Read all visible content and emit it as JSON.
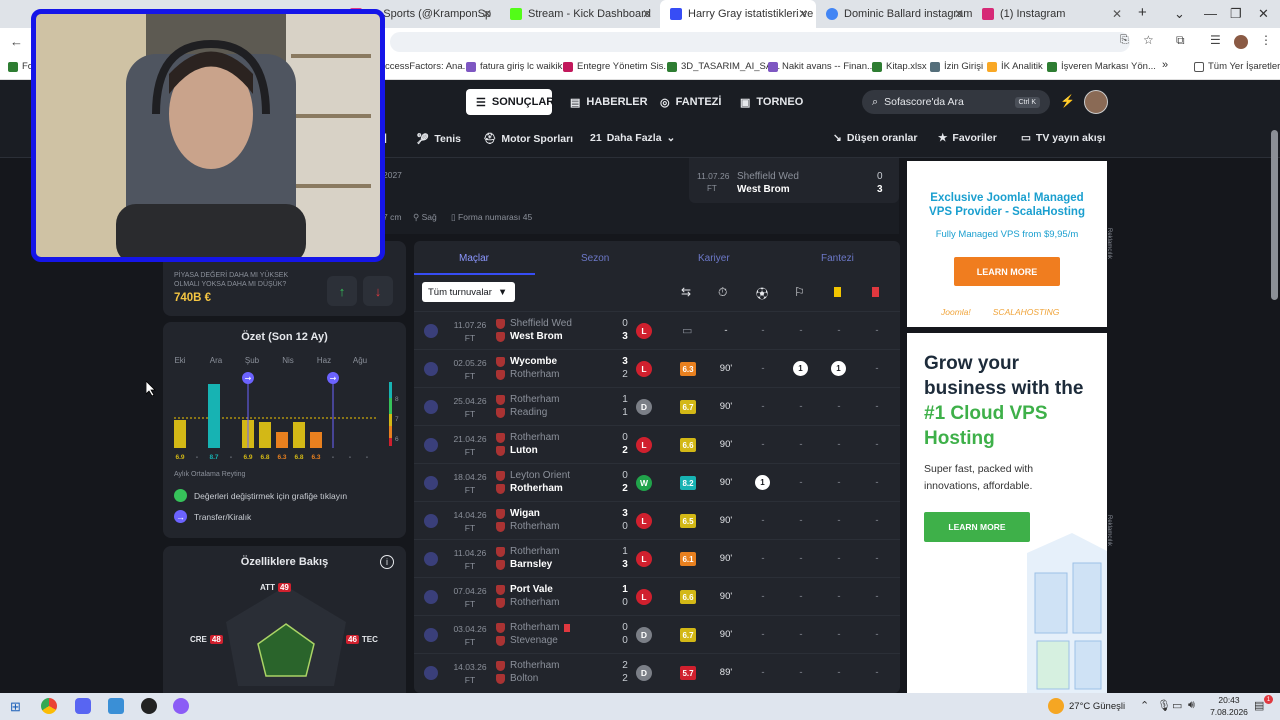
{
  "browser": {
    "tabs": [
      {
        "title": "on Sports (@KramponSp",
        "color": "#e03a8a"
      },
      {
        "title": "Stream - Kick Dashboard",
        "color": "#53fc18"
      },
      {
        "title": "Harry Gray istatistikleri ve reyti",
        "color": "#374df5",
        "active": true
      },
      {
        "title": "Dominic Ballard instagram - Gö",
        "color": "#4285f4"
      },
      {
        "title": "(1) Instagram",
        "color": "#d62976"
      }
    ],
    "new_tab": "+",
    "window_controls": [
      "⌄",
      "—",
      "❐",
      "✕"
    ],
    "bookmarks": [
      {
        "label": "Fo",
        "color": "#2e7d32"
      },
      {
        "label": "ccessFactors: Ana...",
        "color": "#1565c0"
      },
      {
        "label": "fatura giriş lc waikiki",
        "color": "#7e57c2"
      },
      {
        "label": "Entegre Yönetim Sis...",
        "color": "#c2185b"
      },
      {
        "label": "3D_TASARIM_AI_SA...",
        "color": "#2e7d32"
      },
      {
        "label": "Nakit avans -- Finan...",
        "color": "#7e57c2"
      },
      {
        "label": "Kitap.xlsx",
        "color": "#2e7d32"
      },
      {
        "label": "İzin Girişi",
        "color": "#546e7a"
      },
      {
        "label": "İK Analitik",
        "color": "#f9a825"
      },
      {
        "label": "İşveren Markası Yön...",
        "color": "#2e7d32"
      }
    ],
    "bookmarks_more": "»",
    "all_bookmarks": "Tüm Yer İşaretleri"
  },
  "header": {
    "nav": [
      {
        "label": "SONUÇLAR",
        "active": true
      },
      {
        "label": "HABERLER"
      },
      {
        "label": "FANTEZİ"
      },
      {
        "label": "TORNEO"
      }
    ],
    "search_placeholder": "Sofascore'da Ara",
    "search_shortcut": "Ctrl K",
    "subnav": [
      "Tenis",
      "Motor Sporları",
      "Daha Fazla",
      "Düşen oranlar",
      "Favoriler",
      "TV yayın akışı"
    ],
    "subnav_prefix": "21"
  },
  "profile": {
    "contract_year": "2027",
    "height": "7 cm",
    "foot": "Sağ",
    "shirt": "Forma numarası 45"
  },
  "last_match": {
    "date": "11.07.26",
    "status": "FT",
    "home": "Sheffield Wed",
    "away": "West Brom",
    "home_score": "0",
    "away_score": "3"
  },
  "value_vote": {
    "question": "PİYASA DEĞERİ DAHA MI YÜKSEK OLMALI YOKSA DAHA MI DÜŞÜK?",
    "value": "740B €",
    "up": "↑",
    "down": "↓"
  },
  "summary": {
    "title": "Özet (Son 12 Ay)",
    "months": [
      "Eki",
      "Ara",
      "Şub",
      "Nis",
      "Haz",
      "Ağu"
    ],
    "scale": [
      "8",
      "7",
      "6"
    ],
    "bars": [
      {
        "rating": 6.9,
        "label": "6.9",
        "color": "#d3b816"
      },
      {
        "rating": null,
        "label": "-",
        "color": null
      },
      {
        "rating": 8.7,
        "label": "8.7",
        "color": "#17b3b3"
      },
      {
        "rating": null,
        "label": "-",
        "color": null
      },
      {
        "rating": 6.9,
        "label": "6.9",
        "color": "#d3b816"
      },
      {
        "rating": 6.8,
        "label": "6.8",
        "color": "#d3b816"
      },
      {
        "rating": 6.3,
        "label": "6.3",
        "color": "#e8801f"
      },
      {
        "rating": 6.8,
        "label": "6.8",
        "color": "#d3b816"
      },
      {
        "rating": 6.3,
        "label": "6.3",
        "color": "#e8801f"
      },
      {
        "rating": null,
        "label": "-",
        "color": null
      },
      {
        "rating": null,
        "label": "-",
        "color": null
      },
      {
        "rating": null,
        "label": "-",
        "color": null
      }
    ],
    "average_line": 7.0,
    "transfer_markers": [
      4,
      9
    ],
    "avg_label": "Aylık Ortalama Reyting",
    "legend_change": "Değerleri değiştirmek için grafiğe tıklayın",
    "legend_transfer": "Transfer/Kiralık"
  },
  "attributes": {
    "title": "Özelliklere Bakış",
    "labels": [
      {
        "name": "ATT",
        "value": "49"
      },
      {
        "name": "TEC",
        "value": "46"
      },
      {
        "name": "CRE",
        "value": "48"
      }
    ]
  },
  "matches": {
    "tabs": [
      "Maçlar",
      "Sezon",
      "Kariyer",
      "Fantezi"
    ],
    "filter": "Tüm turnuvalar",
    "columns": [
      "lineup-icon",
      "clock-icon",
      "ball-icon",
      "assist-icon",
      "yellow-card-icon",
      "red-card-icon"
    ],
    "rows": [
      {
        "date": "11.07.26",
        "status": "FT",
        "home": "Sheffield Wed",
        "away": "West Brom",
        "hs": "0",
        "as": "3",
        "winner": "away",
        "res": "L",
        "rating": "",
        "mins": "-",
        "goals": "-",
        "assists": "-",
        "yellow": "-",
        "red": "-",
        "bench": true
      },
      {
        "date": "02.05.26",
        "status": "FT",
        "home": "Wycombe",
        "away": "Rotherham",
        "hs": "3",
        "as": "2",
        "winner": "home",
        "res": "L",
        "rating": "6.3",
        "rating_color": "#e8801f",
        "mins": "90'",
        "goals": "-",
        "assists": "1",
        "yellow": "1",
        "red": "-"
      },
      {
        "date": "25.04.26",
        "status": "FT",
        "home": "Rotherham",
        "away": "Reading",
        "hs": "1",
        "as": "1",
        "winner": "",
        "res": "D",
        "rating": "6.7",
        "rating_color": "#d3b816",
        "mins": "90'",
        "goals": "-",
        "assists": "-",
        "yellow": "-",
        "red": "-"
      },
      {
        "date": "21.04.26",
        "status": "FT",
        "home": "Rotherham",
        "away": "Luton",
        "hs": "0",
        "as": "2",
        "winner": "away",
        "res": "L",
        "rating": "6.6",
        "rating_color": "#d3b816",
        "mins": "90'",
        "goals": "-",
        "assists": "-",
        "yellow": "-",
        "red": "-"
      },
      {
        "date": "18.04.26",
        "status": "FT",
        "home": "Leyton Orient",
        "away": "Rotherham",
        "hs": "0",
        "as": "2",
        "winner": "away",
        "res": "W",
        "rating": "8.2",
        "rating_color": "#17b3b3",
        "mins": "90'",
        "goals": "1",
        "assists": "-",
        "yellow": "-",
        "red": "-"
      },
      {
        "date": "14.04.26",
        "status": "FT",
        "home": "Wigan",
        "away": "Rotherham",
        "hs": "3",
        "as": "0",
        "winner": "home",
        "res": "L",
        "rating": "6.5",
        "rating_color": "#d3b816",
        "mins": "90'",
        "goals": "-",
        "assists": "-",
        "yellow": "-",
        "red": "-"
      },
      {
        "date": "11.04.26",
        "status": "FT",
        "home": "Rotherham",
        "away": "Barnsley",
        "hs": "1",
        "as": "3",
        "winner": "away",
        "res": "L",
        "rating": "6.1",
        "rating_color": "#e8801f",
        "mins": "90'",
        "goals": "-",
        "assists": "-",
        "yellow": "-",
        "red": "-"
      },
      {
        "date": "07.04.26",
        "status": "FT",
        "home": "Port Vale",
        "away": "Rotherham",
        "hs": "1",
        "as": "0",
        "winner": "home",
        "res": "L",
        "rating": "6.6",
        "rating_color": "#d3b816",
        "mins": "90'",
        "goals": "-",
        "assists": "-",
        "yellow": "-",
        "red": "-"
      },
      {
        "date": "03.04.26",
        "status": "FT",
        "home": "Rotherham",
        "away": "Stevenage",
        "hs": "0",
        "as": "0",
        "winner": "",
        "res": "D",
        "rating": "6.7",
        "rating_color": "#d3b816",
        "mins": "90'",
        "goals": "-",
        "assists": "-",
        "yellow": "-",
        "red": "-",
        "redflag": true
      },
      {
        "date": "14.03.26",
        "status": "FT",
        "home": "Rotherham",
        "away": "Bolton",
        "hs": "2",
        "as": "2",
        "winner": "",
        "res": "D",
        "rating": "5.7",
        "rating_color": "#d0202e",
        "mins": "89'",
        "goals": "-",
        "assists": "-",
        "yellow": "-",
        "red": "-"
      }
    ]
  },
  "ads": {
    "joomla_title": "Exclusive Joomla! Managed VPS Provider - ScalaHosting",
    "joomla_sub": "Fully Managed VPS from $9,95/m",
    "joomla_btn": "LEARN MORE",
    "joomla_logo1": "Joomla!",
    "joomla_logo2": "SCALAHOSTING",
    "vps_title_1": "Grow your business with the",
    "vps_title_2": "#1 Cloud VPS Hosting",
    "vps_sub": "Super fast, packed with innovations, affordable.",
    "vps_btn": "LEARN MORE",
    "ad_label": "Reklamcılık"
  },
  "taskbar": {
    "weather": "27°C  Güneşli",
    "time": "20:43",
    "date": "7.08.2026",
    "notif": "1"
  },
  "colors": {
    "accent": "#374df5",
    "loss": "#d0202e",
    "draw": "#7b7f87",
    "win": "#21a34b"
  }
}
